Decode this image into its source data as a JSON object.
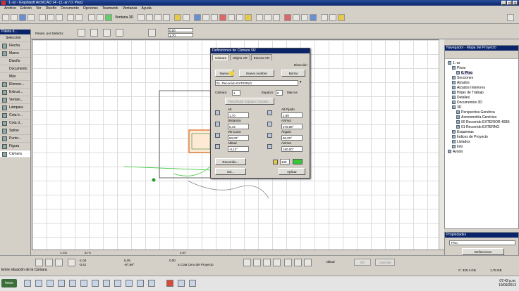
{
  "window": {
    "title": "1.-ar - Graphisoft ArchiCAD 14 - [1.-ar / 0. Piso]"
  },
  "menu": [
    "Archivo",
    "Edición",
    "Ver",
    "Diseño",
    "Documento",
    "Opciones",
    "Teamwork",
    "Ventanas",
    "Ayuda"
  ],
  "toolbar": {
    "view3d_label": "Ventana 3D"
  },
  "infobox": {
    "default_label": "Param. por Defecto:",
    "field1": "0,00",
    "field2": "1,70"
  },
  "toolbox": {
    "header": "Paleta d...",
    "select_label": "Selección",
    "tools": [
      {
        "label": "Flecha"
      },
      {
        "label": "Marco"
      },
      {
        "label": "Diseño"
      },
      {
        "label": "Documento"
      },
      {
        "label": "Más"
      },
      {
        "label": "Elemen..."
      },
      {
        "label": "Extrusi..."
      },
      {
        "label": "Ventan..."
      },
      {
        "label": "Lámpara"
      },
      {
        "label": "Cota Ir..."
      },
      {
        "label": "Cota d..."
      },
      {
        "label": "Spline"
      },
      {
        "label": "Punto..."
      },
      {
        "label": "Figura"
      },
      {
        "label": "Cámara"
      }
    ]
  },
  "canvas": {
    "zoom": "1:100",
    "percent": "83 %",
    "angle": "0,00°"
  },
  "dialog": {
    "title": "Definiciones de Cámara VR",
    "tabs": [
      "Cámara",
      "Objeto VR",
      "Escena VR"
    ],
    "direccion_label": "Dirección",
    "buttons": {
      "nuevo": "Nuevo",
      "nuevo_nombre": "Nuevo nombre",
      "borrar": "Borrar"
    },
    "camera_select": "01. Recorrido EXTERNO",
    "camara_label": "Cámara:",
    "camara_value": "1",
    "espacio_label": "Espacio:",
    "espacio_value": "0",
    "marcos_label": "Marcos",
    "recalc_label": "Recalcular Espacio Cámara...",
    "fields": [
      {
        "label": "Alt.",
        "value": "1,70"
      },
      {
        "label": "Alt.Fijado",
        "value": "1,69"
      },
      {
        "label": "Distancia",
        "value": "5,44"
      },
      {
        "label": "Azimut",
        "value": "275,89°"
      },
      {
        "label": "Ver.Cono",
        "value": "60,00°"
      },
      {
        "label": "Ángulo",
        "value": "90,00°"
      },
      {
        "label": "Altitud",
        "value": "-0,12°"
      },
      {
        "label": "Azimut",
        "value": "180,00°"
      }
    ],
    "recorrido_btn": "Recorrido...",
    "sol_btn": "Sol...",
    "color_value": "100",
    "aplicar_btn": "Aplicar"
  },
  "navigator": {
    "title": "Navegador - Mapa del Proyecto",
    "items": [
      {
        "label": "1.-ar"
      },
      {
        "label": "Pisos"
      },
      {
        "label": "0. Piso",
        "selected": true
      },
      {
        "label": "Secciones"
      },
      {
        "label": "Alzados"
      },
      {
        "label": "Alzados Interiores"
      },
      {
        "label": "Hojas de Trabajo"
      },
      {
        "label": "Detalles"
      },
      {
        "label": "Documentos 3D"
      },
      {
        "label": "3D"
      },
      {
        "label": "Perspectiva Genérica"
      },
      {
        "label": "Axonometría Genérica"
      },
      {
        "label": "00 Recorrido EXTERIOR 46B5"
      },
      {
        "label": "01 Recorrido EXTERNO"
      },
      {
        "label": "Esquemas"
      },
      {
        "label": "Índices de Proyecto"
      },
      {
        "label": "Listados"
      },
      {
        "label": "Info"
      },
      {
        "label": "Ayuda"
      }
    ]
  },
  "properties": {
    "title": "Propiedades",
    "field_value": "Piso",
    "button": "Definiciones"
  },
  "coords": {
    "x1": "-1,04",
    "y1": "-3,41",
    "x2": "6,35",
    "y2": "-87,56°",
    "origin_label": "a Cota Cero del Proyecto",
    "origin_value": "0,00",
    "z_label": "Altitud",
    "ok": "OK",
    "cancel": "Cancelar"
  },
  "status": {
    "message": "Entre situación de la Cámara",
    "disk": "C: 320.4 GB",
    "mem": "1,78 GB"
  },
  "taskbar": {
    "start": "Inicio",
    "time": "07:42 p.m.",
    "date": "10/09/2013"
  }
}
